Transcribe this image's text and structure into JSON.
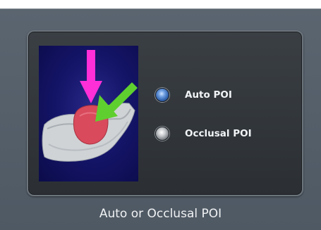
{
  "dialog": {
    "options": [
      {
        "label": "Auto POI",
        "selected": true
      },
      {
        "label": "Occlusal POI",
        "selected": false
      }
    ],
    "caption": "Auto or Occlusal POI"
  },
  "preview": {
    "arrow_magenta_color": "#ff2fd8",
    "arrow_green_color": "#5fcf2f",
    "tooth_color": "#d84a5c",
    "background_color": "#14146a"
  }
}
